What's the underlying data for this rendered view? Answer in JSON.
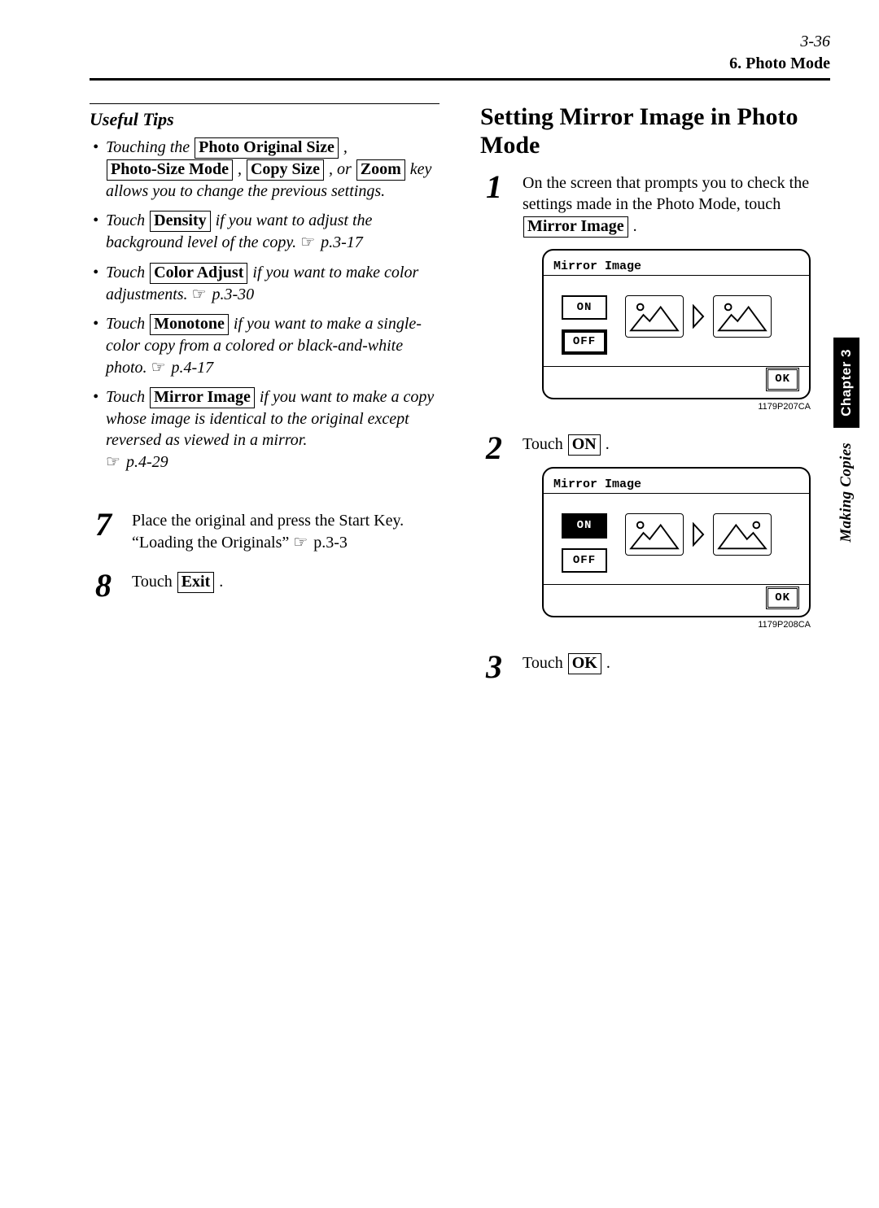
{
  "page_number": "3-36",
  "section_header": "6. Photo Mode",
  "side_tab": {
    "chapter": "Chapter 3",
    "label": "Making Copies"
  },
  "left": {
    "useful_tips_title": "Useful Tips",
    "tips": [
      {
        "t0": "Touching the ",
        "k0": "Photo Original Size",
        "t1": " ,",
        "line2_k0": "Photo-Size Mode",
        "line2_t0": " , ",
        "line2_k1": "Copy Size",
        "line2_t1": " , or ",
        "line2_k2": "Zoom",
        "t2": " key allows you to change the previous settings."
      },
      {
        "t0": "Touch ",
        "k0": "Density",
        "t1": " if you want to adjust the background level of the copy. ",
        "ref": "p.3-17"
      },
      {
        "t0": "Touch ",
        "k0": "Color Adjust",
        "t1": " if you want to make color adjustments. ",
        "ref": "p.3-30"
      },
      {
        "t0": "Touch ",
        "k0": "Monotone",
        "t1": " if you want to make a single-color copy from a colored or black-and-white photo. ",
        "ref": "p.4-17"
      },
      {
        "t0": "Touch ",
        "k0": "Mirror Image",
        "t1": " if you want to make a copy whose image is identical to the original except reversed as viewed in a mirror.",
        "ref": "p.4-29"
      }
    ],
    "steps": [
      {
        "num": "7",
        "text_a": "Place the original and press the Start Key. “Loading the Originals” ",
        "ref": "p.3-3"
      },
      {
        "num": "8",
        "text_a": "Touch ",
        "key": "Exit",
        "text_b": " ."
      }
    ]
  },
  "right": {
    "heading": "Setting Mirror Image in Photo Mode",
    "steps": [
      {
        "num": "1",
        "text_a": "On the screen that prompts you to check the settings made in the Photo Mode, touch ",
        "key": "Mirror Image",
        "text_b": " .",
        "lcd": {
          "title": "Mirror Image",
          "on": "ON",
          "off": "OFF",
          "ok": "OK",
          "on_pressed": false,
          "mirrored": false
        },
        "fig": "1179P207CA"
      },
      {
        "num": "2",
        "text_a": "Touch ",
        "key": "ON",
        "text_b": " .",
        "lcd": {
          "title": "Mirror Image",
          "on": "ON",
          "off": "OFF",
          "ok": "OK",
          "on_pressed": true,
          "mirrored": true
        },
        "fig": "1179P208CA"
      },
      {
        "num": "3",
        "text_a": "Touch ",
        "key": "OK",
        "text_b": " ."
      }
    ]
  }
}
